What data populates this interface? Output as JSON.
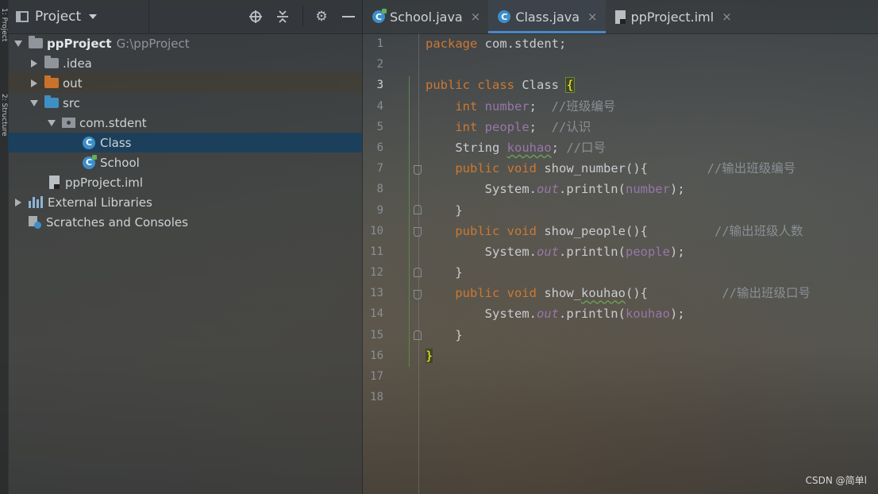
{
  "tool_stripe": {
    "top_label": "1: Project",
    "bottom_label": "2: Structure"
  },
  "project_panel": {
    "title": "Project",
    "tree": [
      {
        "label": "ppProject",
        "path": "G:\\ppProject"
      },
      {
        "label": ".idea"
      },
      {
        "label": "out"
      },
      {
        "label": "src"
      },
      {
        "label": "com.stdent"
      },
      {
        "label": "Class"
      },
      {
        "label": "School"
      },
      {
        "label": "ppProject.iml"
      },
      {
        "label": "External Libraries"
      },
      {
        "label": "Scratches and Consoles"
      }
    ]
  },
  "tabs": [
    {
      "label": "School.java",
      "close": "×"
    },
    {
      "label": "Class.java",
      "close": "×"
    },
    {
      "label": "ppProject.iml",
      "close": "×"
    }
  ],
  "line_numbers": [
    "1",
    "2",
    "3",
    "4",
    "5",
    "6",
    "7",
    "8",
    "9",
    "10",
    "11",
    "12",
    "13",
    "14",
    "15",
    "16",
    "17",
    "18"
  ],
  "code": {
    "l1_pkg": "package",
    "l1_rest": " com.stdent;",
    "l3_public": "public",
    "l3_class": "class",
    "l3_name": " Class ",
    "l3_brace": "{",
    "l4_type": "int",
    "l4_field": "number",
    "l4_semi": ";  ",
    "l4_cmt": "//班级编号",
    "l5_type": "int",
    "l5_field": "people",
    "l5_semi": ";  ",
    "l5_cmt": "//认识",
    "l6_type": "String ",
    "l6_field": "kouhao",
    "l6_semi": "; ",
    "l6_cmt": "//口号",
    "l7_public": "public",
    "l7_void": "void",
    "l7_name": " show_number(){",
    "l7_cmt": "//输出班级编号",
    "l8_a": "System.",
    "l8_out": "out",
    "l8_b": ".println(",
    "l8_field": "number",
    "l8_c": ");",
    "close_brace": "}",
    "l10_public": "public",
    "l10_void": "void",
    "l10_name": " show_people(){",
    "l10_cmt": "//输出班级人数",
    "l11_a": "System.",
    "l11_out": "out",
    "l11_b": ".println(",
    "l11_field": "people",
    "l11_c": ");",
    "l13_public": "public",
    "l13_void": "void",
    "l13_name_a": " show_",
    "l13_name_b": "kouhao",
    "l13_name_c": "(){",
    "l13_cmt": "//输出班级口号",
    "l14_a": "System.",
    "l14_out": "out",
    "l14_b": ".println(",
    "l14_field": "kouhao",
    "l14_c": ");",
    "l16_brace": "}"
  },
  "watermark": "CSDN @简单l",
  "colors": {
    "keyword": "#cc7832",
    "field": "#9876aa",
    "comment": "#8a8f94",
    "selection": "#164060",
    "accent": "#4a88c7"
  }
}
